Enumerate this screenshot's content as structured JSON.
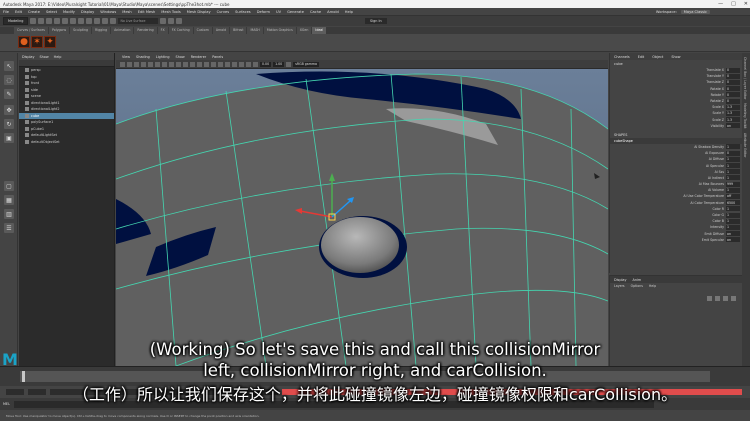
{
  "window": {
    "title": "Autodesk Maya 2017: E:\\Video\\Pluralsight Tutorial\\01\\Maya\\Studio\\Maya\\scenes\\Settings\\ppThe3hot.mb* --- cube",
    "controls": [
      "—",
      "□",
      "✕"
    ]
  },
  "menubar": {
    "items": [
      "File",
      "Edit",
      "Create",
      "Select",
      "Modify",
      "Display",
      "Windows",
      "Mesh",
      "Edit Mesh",
      "Mesh Tools",
      "Mesh Display",
      "Curves",
      "Surfaces",
      "Deform",
      "UV",
      "Generate",
      "Cache",
      "Arnold",
      "Help"
    ],
    "workspace_label": "Workspace:",
    "workspace_value": "Maya Classic"
  },
  "statusline": {
    "menuset": "Modeling",
    "live_surface": "No Live Surface",
    "sign_in": "Sign In"
  },
  "shelf": {
    "tabs": [
      "Curves / Surfaces",
      "Polygons",
      "Sculpting",
      "Rigging",
      "Animation",
      "Rendering",
      "FX",
      "FX Caching",
      "Custom",
      "Arnold",
      "Bifrost",
      "MASH",
      "Motion Graphics",
      "XGen",
      "Ideal"
    ],
    "active_tab": "Ideal"
  },
  "outliner": {
    "menu": [
      "Display",
      "Show",
      "Help"
    ],
    "items": [
      {
        "label": "persp",
        "selected": false
      },
      {
        "label": "top",
        "selected": false
      },
      {
        "label": "front",
        "selected": false
      },
      {
        "label": "side",
        "selected": false
      },
      {
        "label": "scene",
        "selected": false
      },
      {
        "label": "directionalLight1",
        "selected": false
      },
      {
        "label": "directionalLight2",
        "selected": false
      },
      {
        "label": "cube",
        "selected": true
      },
      {
        "label": "polySurface1",
        "selected": false
      },
      {
        "label": "pCube1",
        "selected": false
      },
      {
        "label": "defaultLightSet",
        "selected": false
      },
      {
        "label": "defaultObjectSet",
        "selected": false
      }
    ]
  },
  "viewport": {
    "menu": [
      "View",
      "Shading",
      "Lighting",
      "Show",
      "Renderer",
      "Panels"
    ],
    "near_value": "0.00",
    "far_value": "1.00",
    "color_space": "sRGB gamma"
  },
  "channelbox": {
    "menu": [
      "Channels",
      "Edit",
      "Object",
      "Show"
    ],
    "object": "cube",
    "channels": [
      {
        "label": "Translate X",
        "value": "0"
      },
      {
        "label": "Translate Y",
        "value": "0"
      },
      {
        "label": "Translate Z",
        "value": "0"
      },
      {
        "label": "Rotate X",
        "value": "0"
      },
      {
        "label": "Rotate Y",
        "value": "0"
      },
      {
        "label": "Rotate Z",
        "value": "0"
      },
      {
        "label": "Scale X",
        "value": "1.3"
      },
      {
        "label": "Scale Y",
        "value": "1.3"
      },
      {
        "label": "Scale Z",
        "value": "1.3"
      },
      {
        "label": "Visibility",
        "value": "on"
      }
    ],
    "shapes_header": "SHAPES",
    "shape_name": "cubeShape",
    "shape_channels": [
      {
        "label": "Ai Shadow Density",
        "value": "1"
      },
      {
        "label": "Ai Exposure",
        "value": "0"
      },
      {
        "label": "Ai Diffuse",
        "value": "1"
      },
      {
        "label": "Ai Specular",
        "value": "1"
      },
      {
        "label": "Ai Sss",
        "value": "1"
      },
      {
        "label": "Ai Indirect",
        "value": "1"
      },
      {
        "label": "Ai Max Bounces",
        "value": "999"
      },
      {
        "label": "Ai Volume",
        "value": "1"
      },
      {
        "label": "Ai Use Color Temperature",
        "value": "off"
      },
      {
        "label": "Ai Color Temperature",
        "value": "6500"
      },
      {
        "label": "Color R",
        "value": "1"
      },
      {
        "label": "Color G",
        "value": "1"
      },
      {
        "label": "Color B",
        "value": "1"
      },
      {
        "label": "Intensity",
        "value": "1"
      },
      {
        "label": "Emit Diffuse",
        "value": "on"
      },
      {
        "label": "Emit Specular",
        "value": "on"
      }
    ]
  },
  "layers": {
    "tabs": [
      "Display",
      "Anim"
    ],
    "menu": [
      "Layers",
      "Options",
      "Help"
    ]
  },
  "sidetabs": [
    "Channel Box / Layer Editor",
    "Modeling Toolkit",
    "Attribute Editor"
  ],
  "cmdline": {
    "label": "MEL"
  },
  "helpline": {
    "text": "Move Tool: Use manipulator to move object(s). Ctrl+middle-drag to move components along normals. Use D or INSERT to change the pivot position and axis orientation."
  },
  "logo": {
    "text": "M"
  },
  "subtitles": {
    "en_line1": "(Working) So let's save this and call this collisionMirror",
    "en_line2": "left, collisionMirror right, and carCollision.",
    "zh_line": "（工作）所以让我们保存这个，并将此碰撞镜像左边，碰撞镜像权限和carCollision。"
  },
  "colors": {
    "selection": "#5285a6",
    "ground_dark": "#001040",
    "wire": "#44d6b0",
    "subtitle": "#ffffff",
    "timeline_red": "#e04c4c",
    "maya_blue": "#1aa3c7"
  }
}
